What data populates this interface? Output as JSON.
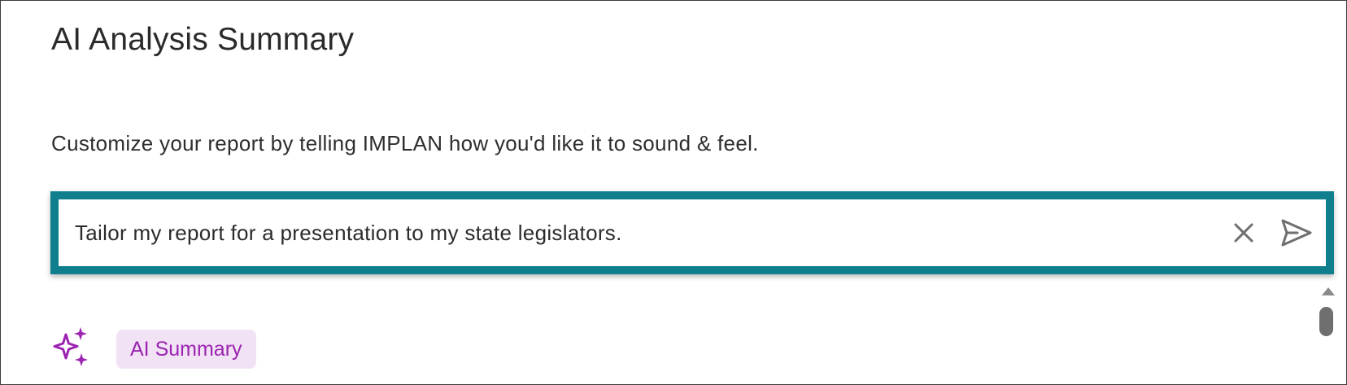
{
  "header": {
    "title": "AI Analysis Summary"
  },
  "main": {
    "instructions": "Customize your report by telling IMPLAN how you'd like it to sound & feel.",
    "prompt": {
      "value": "Tailor my report for a presentation to my state legislators.",
      "placeholder": "",
      "clear_icon": "close-icon",
      "send_icon": "send-icon"
    },
    "summary": {
      "icon": "sparkle-icon",
      "badge_label": "AI Summary"
    }
  },
  "colors": {
    "accent": "#0f7f8d",
    "badge_bg": "#f1e2f5",
    "badge_text": "#9b24b0",
    "icon_gray": "#6f6f6f"
  }
}
